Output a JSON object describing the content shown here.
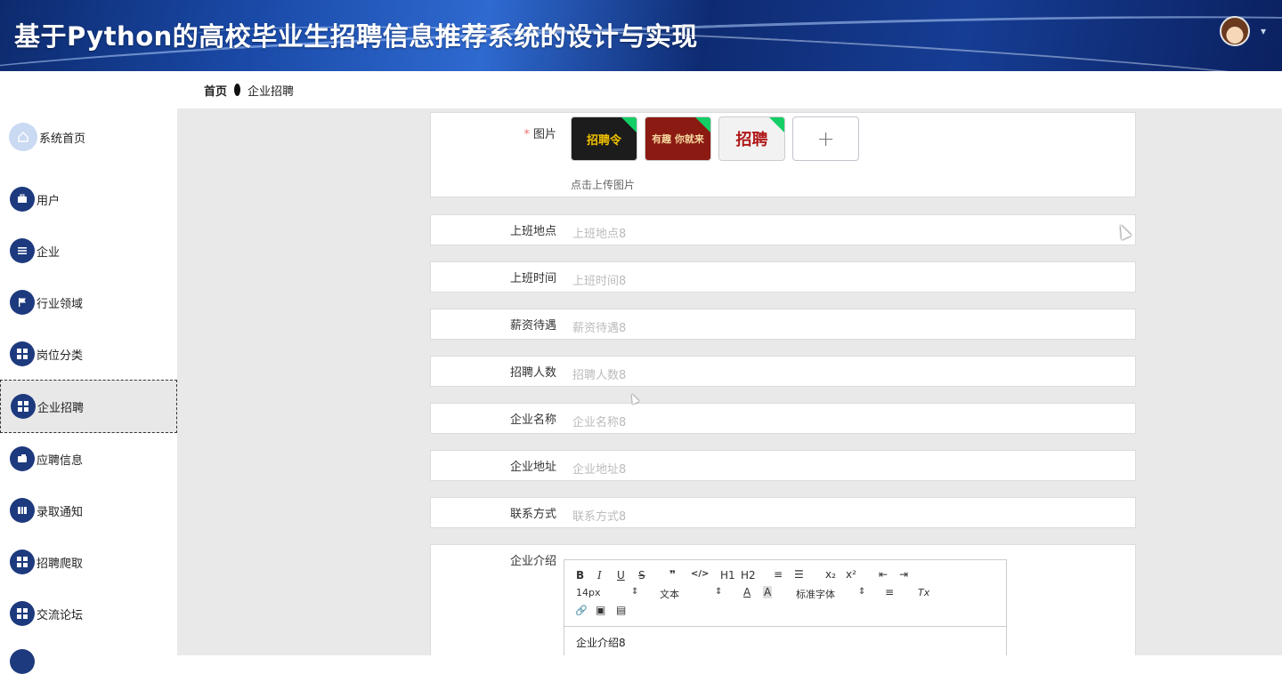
{
  "header": {
    "title": "基于Python的高校毕业生招聘信息推荐系统的设计与实现",
    "caret": "▾"
  },
  "breadcrumb": {
    "home": "首页",
    "current": "企业招聘"
  },
  "sidebar": {
    "items": [
      {
        "label": "系统首页",
        "icon": "home-icon"
      },
      {
        "label": "用户",
        "icon": "briefcase-icon"
      },
      {
        "label": "企业",
        "icon": "list-icon"
      },
      {
        "label": "行业领域",
        "icon": "flag-icon"
      },
      {
        "label": "岗位分类",
        "icon": "grid-icon"
      },
      {
        "label": "企业招聘",
        "icon": "grid-icon"
      },
      {
        "label": "应聘信息",
        "icon": "wallet-icon"
      },
      {
        "label": "录取通知",
        "icon": "book-icon"
      },
      {
        "label": "招聘爬取",
        "icon": "grid-icon"
      },
      {
        "label": "交流论坛",
        "icon": "grid-icon"
      }
    ]
  },
  "form": {
    "image": {
      "label": "图片",
      "required_mark": "*",
      "hint": "点击上传图片",
      "thumbs": [
        "招聘令",
        "有趣 你就来",
        "招聘"
      ],
      "upload_symbol": "+"
    },
    "fields": [
      {
        "label": "上班地点",
        "value": "上班地点8"
      },
      {
        "label": "上班时间",
        "value": "上班时间8"
      },
      {
        "label": "薪资待遇",
        "value": "薪资待遇8"
      },
      {
        "label": "招聘人数",
        "value": "招聘人数8"
      },
      {
        "label": "企业名称",
        "value": "企业名称8"
      },
      {
        "label": "企业地址",
        "value": "企业地址8"
      },
      {
        "label": "联系方式",
        "value": "联系方式8"
      }
    ],
    "intro": {
      "label": "企业介绍",
      "content": "企业介绍8",
      "toolbar": {
        "bold": "B",
        "italic": "I",
        "underline": "U",
        "strike": "S",
        "quote": "❞",
        "code": "</>",
        "h1": "H1",
        "h2": "H2",
        "ordered_list": "≡",
        "bullet_list": "☰",
        "sub": "x₂",
        "sup": "x²",
        "outdent": "⇤",
        "indent": "⇥",
        "size": "14px",
        "size_arrow": "⇕",
        "paragraph": "文本",
        "paragraph_arrow": "⇕",
        "font_color": "A",
        "bg_color": "A",
        "font": "标准字体",
        "font_arrow": "⇕",
        "align": "≡",
        "clean": "Tx",
        "link": "🔗",
        "image": "▣",
        "video": "▤"
      }
    }
  }
}
